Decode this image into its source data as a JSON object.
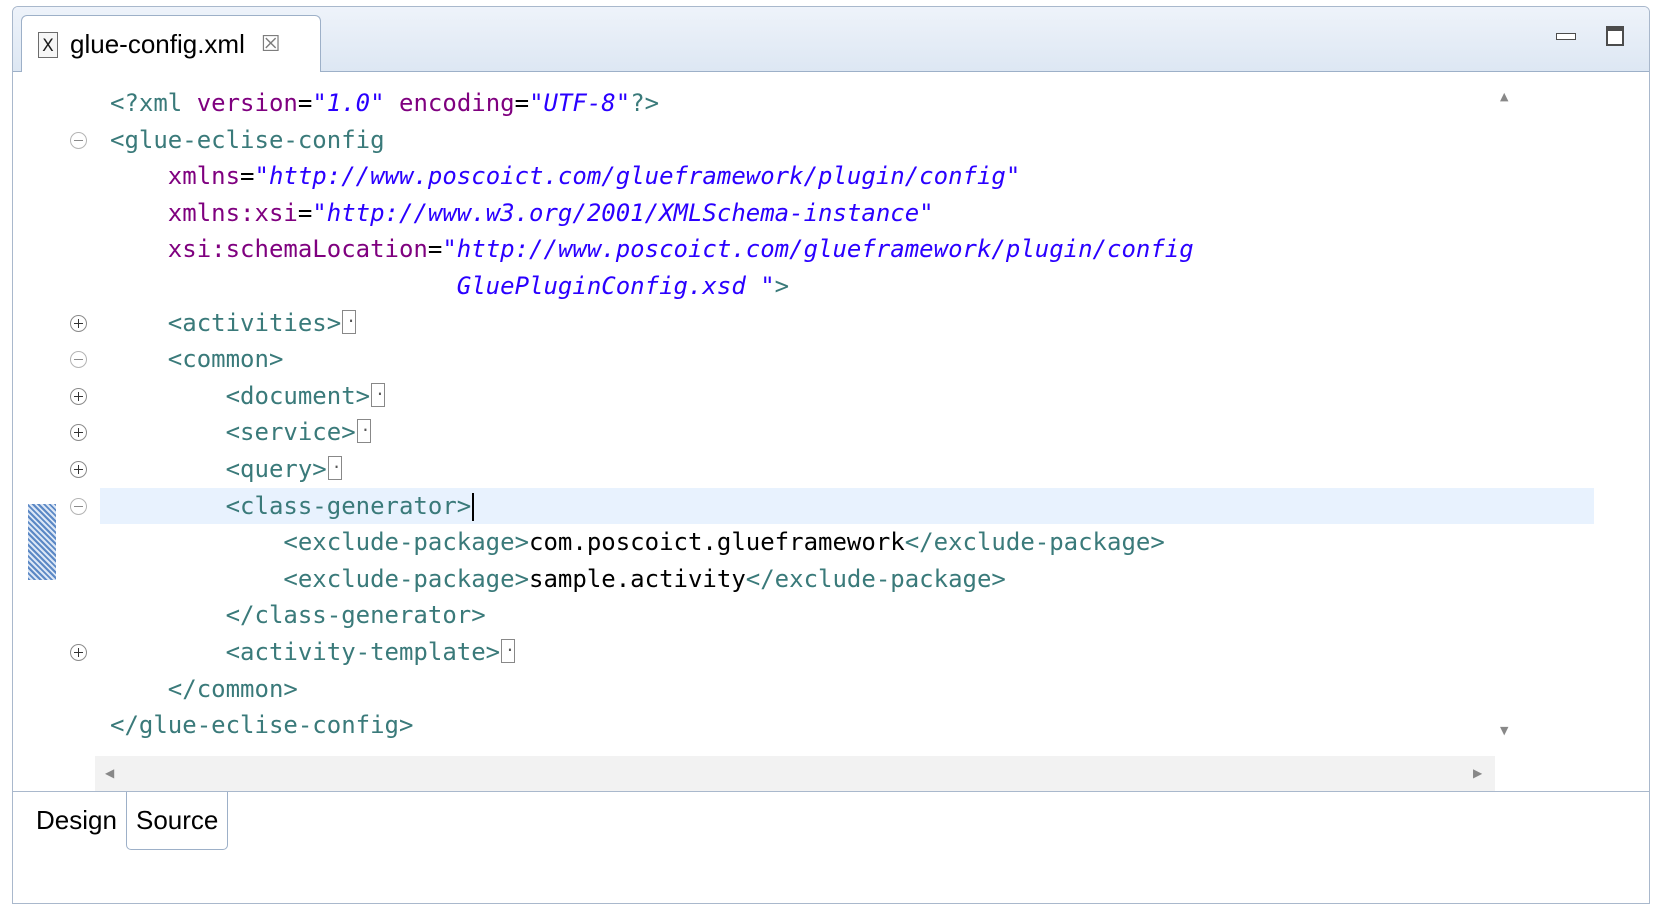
{
  "editor_tab": {
    "icon": "xml-file-icon",
    "icon_glyph": "X",
    "filename": "glue-config.xml",
    "close_glyph": "☒"
  },
  "code_lines": [
    [
      {
        "t": "tag",
        "v": "<?"
      },
      {
        "t": "tag",
        "v": "xml "
      },
      {
        "t": "attr",
        "v": "version"
      },
      {
        "t": "txt",
        "v": "="
      },
      {
        "t": "val",
        "v": "\"1.0\""
      },
      {
        "t": "txt",
        "v": " "
      },
      {
        "t": "attr",
        "v": "encoding"
      },
      {
        "t": "txt",
        "v": "="
      },
      {
        "t": "val",
        "v": "\"UTF-8\""
      },
      {
        "t": "tag",
        "v": "?>"
      }
    ],
    [
      {
        "t": "tag",
        "v": "<glue-eclise-config"
      }
    ],
    [
      {
        "t": "txt",
        "v": "    "
      },
      {
        "t": "attr",
        "v": "xmlns"
      },
      {
        "t": "txt",
        "v": "="
      },
      {
        "t": "val",
        "v": "\"http://www.poscoict.com/glueframework/plugin/config\""
      }
    ],
    [
      {
        "t": "txt",
        "v": "    "
      },
      {
        "t": "attr",
        "v": "xmlns:xsi"
      },
      {
        "t": "txt",
        "v": "="
      },
      {
        "t": "val",
        "v": "\"http://www.w3.org/2001/XMLSchema-instance\""
      }
    ],
    [
      {
        "t": "txt",
        "v": "    "
      },
      {
        "t": "attr",
        "v": "xsi:schemaLocation"
      },
      {
        "t": "txt",
        "v": "="
      },
      {
        "t": "val",
        "v": "\"http://www.poscoict.com/glueframework/plugin/config"
      }
    ],
    [
      {
        "t": "txt",
        "v": "                        "
      },
      {
        "t": "val",
        "v": "GluePluginConfig.xsd \""
      },
      {
        "t": "tag",
        "v": ">"
      }
    ],
    [
      {
        "t": "txt",
        "v": "    "
      },
      {
        "t": "tag",
        "v": "<activities>"
      },
      {
        "t": "fold",
        "v": ""
      }
    ],
    [
      {
        "t": "txt",
        "v": "    "
      },
      {
        "t": "tag",
        "v": "<common>"
      }
    ],
    [
      {
        "t": "txt",
        "v": "        "
      },
      {
        "t": "tag",
        "v": "<document>"
      },
      {
        "t": "fold",
        "v": ""
      }
    ],
    [
      {
        "t": "txt",
        "v": "        "
      },
      {
        "t": "tag",
        "v": "<service>"
      },
      {
        "t": "fold",
        "v": ""
      }
    ],
    [
      {
        "t": "txt",
        "v": "        "
      },
      {
        "t": "tag",
        "v": "<query>"
      },
      {
        "t": "fold",
        "v": ""
      }
    ],
    [
      {
        "t": "txt",
        "v": "        "
      },
      {
        "t": "tag",
        "v": "<class-generator>"
      },
      {
        "t": "caret",
        "v": ""
      }
    ],
    [
      {
        "t": "txt",
        "v": "            "
      },
      {
        "t": "tag",
        "v": "<exclude-package>"
      },
      {
        "t": "txt",
        "v": "com.poscoict.glueframework"
      },
      {
        "t": "tag",
        "v": "</exclude-package>"
      }
    ],
    [
      {
        "t": "txt",
        "v": "            "
      },
      {
        "t": "tag",
        "v": "<exclude-package>"
      },
      {
        "t": "txt",
        "v": "sample.activity"
      },
      {
        "t": "tag",
        "v": "</exclude-package>"
      }
    ],
    [
      {
        "t": "txt",
        "v": "        "
      },
      {
        "t": "tag",
        "v": "</class-generator>"
      }
    ],
    [
      {
        "t": "txt",
        "v": "        "
      },
      {
        "t": "tag",
        "v": "<activity-template>"
      },
      {
        "t": "fold",
        "v": ""
      }
    ],
    [
      {
        "t": "txt",
        "v": "    "
      },
      {
        "t": "tag",
        "v": "</common>"
      }
    ],
    [
      {
        "t": "tag",
        "v": "</glue-eclise-config>"
      }
    ]
  ],
  "fold_markers": [
    {
      "line": 2,
      "state": "collapse"
    },
    {
      "line": 7,
      "state": "expand"
    },
    {
      "line": 8,
      "state": "collapse"
    },
    {
      "line": 9,
      "state": "expand"
    },
    {
      "line": 10,
      "state": "expand"
    },
    {
      "line": 11,
      "state": "expand"
    },
    {
      "line": 12,
      "state": "collapse"
    },
    {
      "line": 16,
      "state": "expand"
    }
  ],
  "current_line": 12,
  "scrollbar_glyphs": {
    "up": "▲",
    "down": "▼",
    "left": "◀",
    "right": "▶"
  },
  "bottom_tabs": [
    {
      "label": "Design",
      "selected": false
    },
    {
      "label": "Source",
      "selected": true
    }
  ],
  "colors": {
    "tag": "#3a7a7a",
    "attribute": "#7f007f",
    "value": "#2a00ff",
    "current_line": "#e8f2fe"
  }
}
